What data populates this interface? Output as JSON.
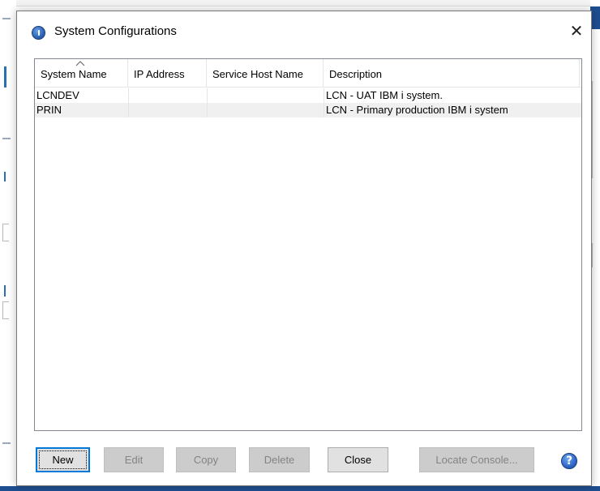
{
  "window": {
    "title": "System Configurations",
    "close_glyph": "✕"
  },
  "table": {
    "columns": [
      "System Name",
      "IP Address",
      "Service Host Name",
      "Description"
    ],
    "sorted_column": "System Name",
    "rows": [
      {
        "system_name": "LCNDEV",
        "ip_address": "",
        "service_host_name": "",
        "description": "LCN - UAT IBM i system."
      },
      {
        "system_name": "PRIN",
        "ip_address": "",
        "service_host_name": "",
        "description": "LCN - Primary production IBM i system"
      }
    ]
  },
  "buttons": {
    "new": "New",
    "edit": "Edit",
    "copy": "Copy",
    "delete": "Delete",
    "close": "Close",
    "locate_console": "Locate Console...",
    "help": "?"
  },
  "colors": {
    "accent": "#0078d7",
    "window_blue": "#1e4e90",
    "disabled_text": "#838383"
  },
  "icons": {
    "app": "ibm-i-access-icon",
    "close": "close-icon",
    "sort": "sort-ascending-icon",
    "help": "help-icon"
  }
}
